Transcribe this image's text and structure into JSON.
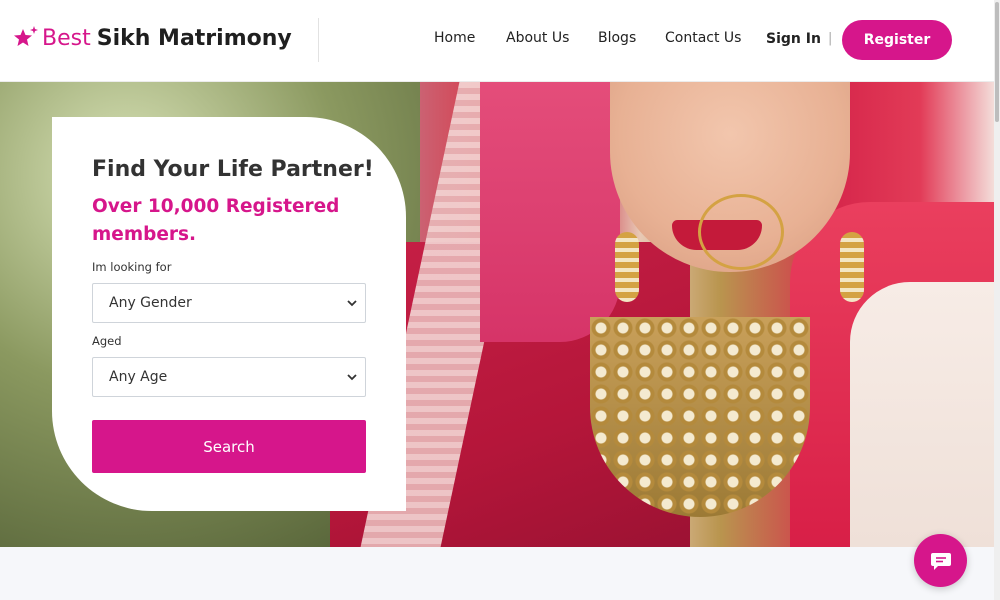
{
  "logo": {
    "prefix": "Best",
    "name": "Sikh Matrimony",
    "icon": "star-sparkle-icon"
  },
  "nav": {
    "items": [
      "Home",
      "About Us",
      "Blogs",
      "Contact Us"
    ],
    "signin": "Sign In",
    "separator": "|",
    "register": "Register"
  },
  "search_card": {
    "title": "Find Your Life Partner!",
    "subtitle": "Over 10,000 Registered members.",
    "looking_for_label": "Im looking for",
    "gender_value": "Any Gender",
    "aged_label": "Aged",
    "age_value": "Any Age",
    "search_button": "Search"
  },
  "chat_widget": {
    "icon": "chat-bubble-icon"
  },
  "colors": {
    "accent": "#d6168b",
    "text_dark": "#333333"
  }
}
